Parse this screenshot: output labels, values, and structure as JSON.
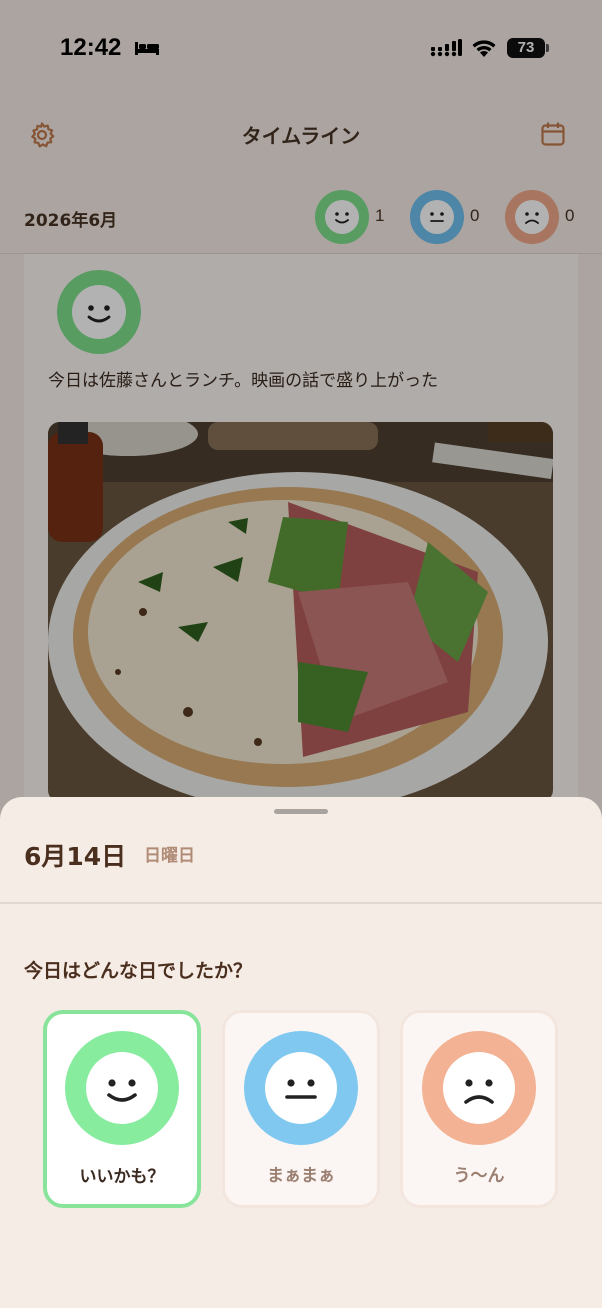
{
  "status_bar": {
    "time": "12:42",
    "battery": "73"
  },
  "navbar": {
    "title": "タイムライン"
  },
  "summary": {
    "month": "2026年6月",
    "counts": [
      {
        "mood": "good",
        "count": "1",
        "color": "#7ee08d"
      },
      {
        "mood": "neutral",
        "count": "0",
        "color": "#6fc0ee"
      },
      {
        "mood": "bad",
        "count": "0",
        "color": "#f0a88a"
      }
    ]
  },
  "entry": {
    "mood": "good",
    "text": "今日は佐藤さんとランチ。映画の話で盛り上がった",
    "photo": "pizza-photo"
  },
  "sheet": {
    "date": "6月14日",
    "weekday": "日曜日",
    "question": "今日はどんな日でしたか？",
    "options": [
      {
        "label": "いいかも？",
        "color": "#88ec9e",
        "selected": true
      },
      {
        "label": "まぁまぁ",
        "color": "#80c8f0",
        "selected": false
      },
      {
        "label": "う〜ん",
        "color": "#f3b293",
        "selected": false
      }
    ]
  }
}
